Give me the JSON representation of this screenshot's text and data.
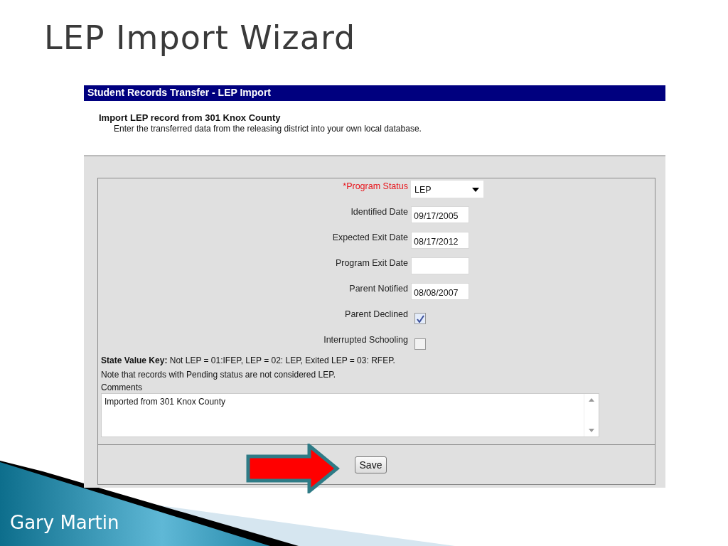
{
  "slide": {
    "title": "LEP Import Wizard",
    "footer": "Gary Martin"
  },
  "window": {
    "title": "Student Records Transfer - LEP Import"
  },
  "intro": {
    "heading": "Import LEP record from 301 Knox County",
    "description": "Enter the transferred data from the releasing district into your own local database."
  },
  "fields": [
    {
      "kind": "select",
      "label": "*Program Status",
      "required": true,
      "value": "LEP"
    },
    {
      "kind": "date",
      "label": "Identified Date",
      "required": false,
      "value": "09/17/2005"
    },
    {
      "kind": "date",
      "label": "Expected Exit Date",
      "required": false,
      "value": "08/17/2012"
    },
    {
      "kind": "date",
      "label": "Program Exit Date",
      "required": false
    },
    {
      "kind": "date",
      "label": "Parent Notified",
      "required": false,
      "value": "08/08/2007"
    },
    {
      "kind": "checkbox",
      "label": "Parent Declined",
      "required": false,
      "checked": true
    },
    {
      "kind": "checkbox",
      "label": "Interrupted Schooling",
      "required": false,
      "checked": false
    }
  ],
  "notes": [
    "**State Value Key:** Not LEP = 01:IFEP, LEP = 02: LEP, Exited LEP = 03: RFEP.",
    "Note that records with Pending status are not considered LEP."
  ],
  "comments": {
    "label": "Comments",
    "value": "Imported from 301 Knox County"
  },
  "buttons": [
    {
      "label": "Save"
    }
  ]
}
